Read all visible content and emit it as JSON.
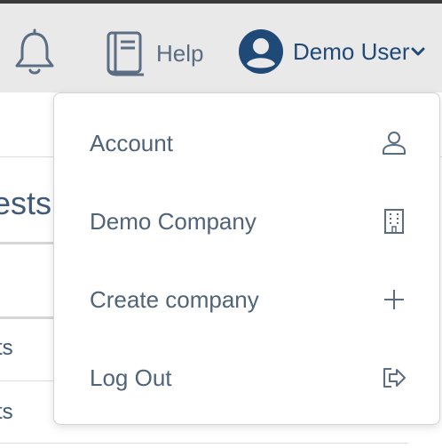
{
  "topbar": {
    "notifications_icon": "bell-icon",
    "help": {
      "icon": "book-icon",
      "label": "Help"
    },
    "user": {
      "avatar_icon": "user-avatar-icon",
      "name": "Demo User",
      "dropdown_icon": "chevron-down-icon"
    }
  },
  "background": {
    "section_title_fragment": "ests",
    "row1_fragment": "ts",
    "row2_fragment": "ts"
  },
  "menu": {
    "items": [
      {
        "label": "Account",
        "icon": "user-outline-icon"
      },
      {
        "label": "Demo Company",
        "icon": "building-icon"
      },
      {
        "label": "Create company",
        "icon": "plus-icon"
      },
      {
        "label": "Log Out",
        "icon": "logout-icon"
      }
    ]
  },
  "colors": {
    "topbar_bg": "#e9e9ea",
    "brand_blue": "#1f4a78",
    "text_muted": "#5a6d82",
    "menu_text": "#4f6479"
  }
}
